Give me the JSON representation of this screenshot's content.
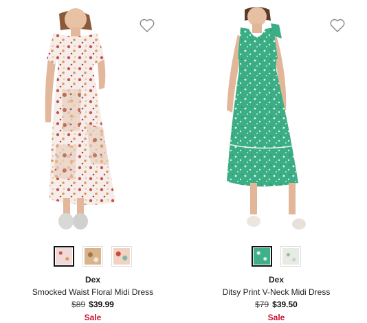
{
  "colors": {
    "sale": "#c8102e",
    "price": "#111111"
  },
  "products": [
    {
      "brand": "Dex",
      "name": "Smocked Waist Floral Midi Dress",
      "original_price": "$89",
      "sale_price": "$39.99",
      "badge": "Sale",
      "favorite_icon": "heart-outline-icon",
      "swatches": [
        {
          "color": "#f1d9d9",
          "selected": true
        },
        {
          "color": "#d8b48c",
          "selected": false
        },
        {
          "color": "#e0a68e",
          "selected": false
        }
      ]
    },
    {
      "brand": "Dex",
      "name": "Ditsy Print V-Neck Midi Dress",
      "original_price": "$79",
      "sale_price": "$39.50",
      "badge": "Sale",
      "favorite_icon": "heart-outline-icon",
      "swatches": [
        {
          "color": "#3fb08a",
          "selected": true
        },
        {
          "color": "#e6ebe4",
          "selected": false
        }
      ]
    }
  ]
}
